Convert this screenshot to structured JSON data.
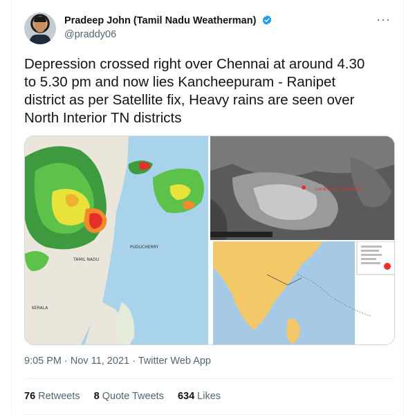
{
  "author": {
    "display_name": "Pradeep John (Tamil Nadu Weatherman)",
    "handle": "@praddy06",
    "avatar_icon": "profile-photo",
    "verified_icon": "verified-badge-icon",
    "verified_color": "#1d9bf0"
  },
  "menu": {
    "more_label": "···"
  },
  "tweet": {
    "text": "Depression crossed right over Chennai at around 4.30\nto 5.30 pm and now lies Kancheepuram - Ranipet\ndistrict as per Satellite fix, Heavy rains are seen over\nNorth Interior TN districts"
  },
  "media": {
    "radar": {
      "labels": {
        "tamil_nadu": "TAMIL NADU",
        "puducherry": "PUDUCHERRY",
        "kerala": "KERALA"
      }
    },
    "satellite": {
      "annotation": "Location of Depression"
    }
  },
  "meta": {
    "timestamp": "9:05 PM · Nov 11, 2021 · Twitter Web App"
  },
  "stats": {
    "retweets_count": "76",
    "retweets_label": " Retweets",
    "quotes_count": "8",
    "quotes_label": " Quote Tweets",
    "likes_count": "634",
    "likes_label": " Likes"
  }
}
